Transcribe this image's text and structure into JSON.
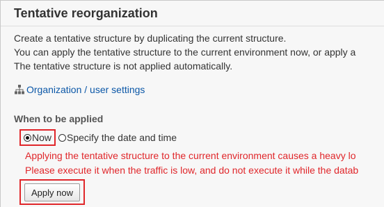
{
  "page": {
    "title": "Tentative reorganization",
    "description_lines": [
      "Create a tentative structure by duplicating the current structure.",
      "You can apply the tentative structure to the current environment now, or apply a",
      "The tentative structure is not applied automatically."
    ]
  },
  "org_link": {
    "icon": "org-chart-icon",
    "label": "Organization / user settings"
  },
  "when_applied": {
    "label": "When to be applied",
    "options": [
      {
        "label": "Now",
        "selected": true
      },
      {
        "label": "Specify the date and time",
        "selected": false
      }
    ],
    "warnings": [
      "Applying the tentative structure to the current environment causes a heavy lo",
      "Please execute it when the traffic is low, and do not execute it while the datab"
    ]
  },
  "actions": {
    "apply_now_label": "Apply now"
  },
  "colors": {
    "link": "#0b57a7",
    "warning": "#e0262a",
    "highlight_box": "#e0262a",
    "panel_bg": "#f7f7f7"
  }
}
